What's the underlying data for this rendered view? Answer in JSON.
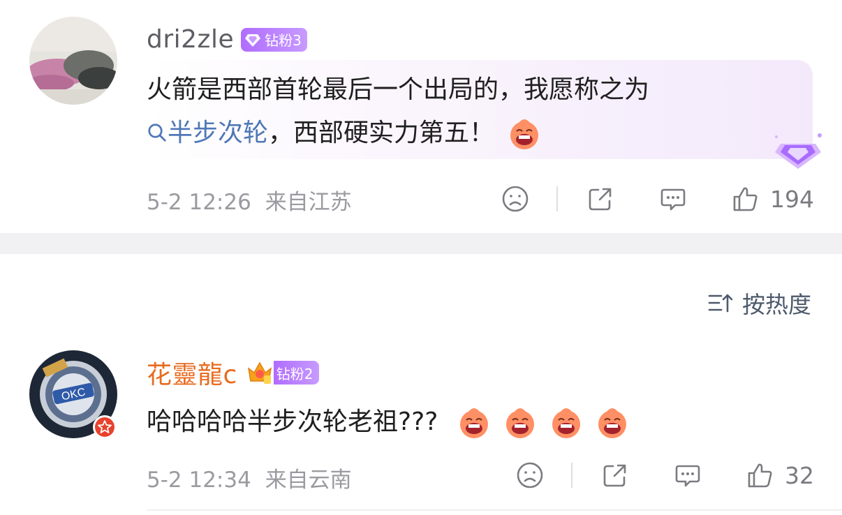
{
  "comments": [
    {
      "username": "dri2zle",
      "badge": "钻粉3",
      "text_main": "火箭是西部首轮最后一个出局的，我愿称之为",
      "topic": "半步次轮",
      "text_after": "，西部硬实力第五！",
      "time": "5-2 12:26",
      "location": "来自江苏",
      "likes": "194"
    },
    {
      "username": "花靈龍c",
      "badge": "钻粉2",
      "text": "哈哈哈哈半步次轮老祖???",
      "time": "5-2 12:34",
      "location": "来自云南",
      "likes": "32"
    }
  ],
  "sort": {
    "label": "按热度"
  },
  "colors": {
    "accent_purple": "#b06cff",
    "vip_orange": "#e86b1f",
    "topic_blue": "#4f78b7"
  }
}
